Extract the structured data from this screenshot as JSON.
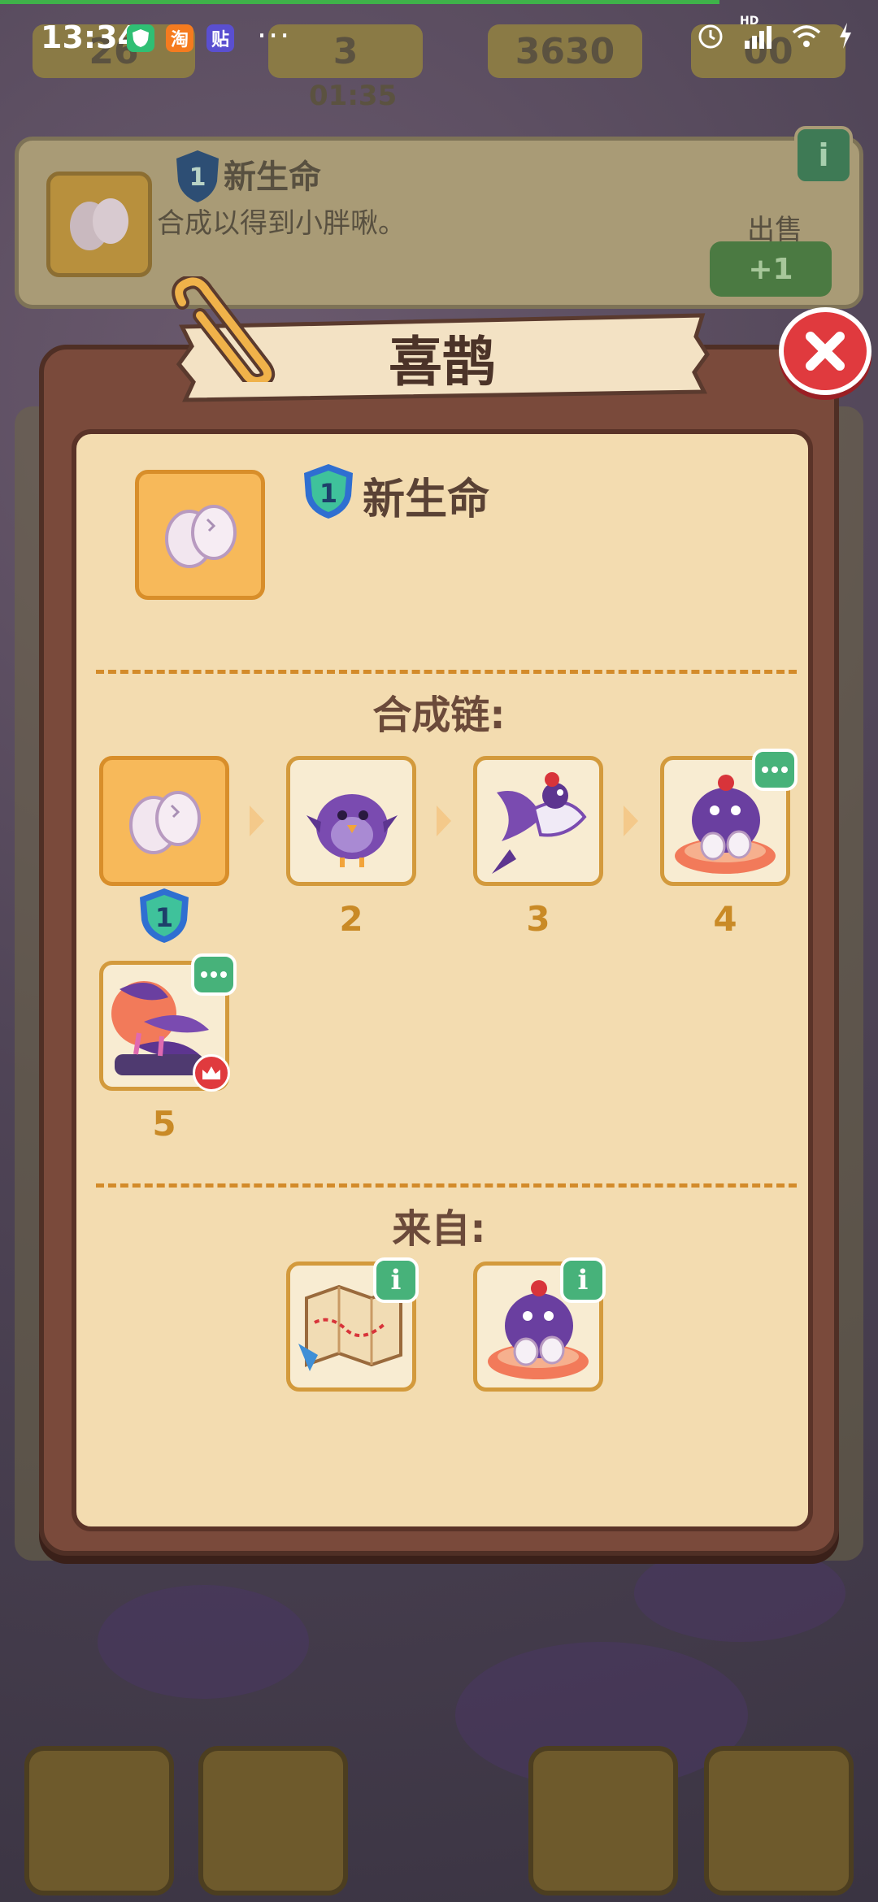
{
  "status_bar": {
    "time": "13:34",
    "apps": [
      "淘",
      "贴"
    ],
    "more": "···",
    "network_label": "HD"
  },
  "background": {
    "hud": {
      "value1": "26",
      "value2": "3",
      "value3": "3630",
      "value4": "00",
      "timer": "01:35"
    },
    "panel": {
      "level": "1",
      "title": "新生命",
      "description": "合成以得到小胖啾。",
      "sell_label": "出售",
      "sell_price": "+1"
    }
  },
  "dialog": {
    "title": "喜鹊",
    "current_item": {
      "level": "1",
      "name": "新生命"
    },
    "chain_title": "合成链:",
    "chain": [
      {
        "level": "1",
        "name": "eggs"
      },
      {
        "level": "2",
        "name": "purple-chick"
      },
      {
        "level": "3",
        "name": "flying-magpie"
      },
      {
        "level": "4",
        "name": "nesting-magpie"
      },
      {
        "level": "5",
        "name": "magpie-flock"
      }
    ],
    "from_title": "来自:",
    "sources": [
      {
        "name": "treasure-map"
      },
      {
        "name": "nesting-magpie"
      }
    ]
  },
  "colors": {
    "accent_gold": "#f7b95a",
    "level_text": "#c98a26",
    "badge_green": "#47b27a",
    "close_red": "#e03a3e",
    "shield_blue": "#2f6fd1",
    "shield_teal": "#3fc29b"
  }
}
